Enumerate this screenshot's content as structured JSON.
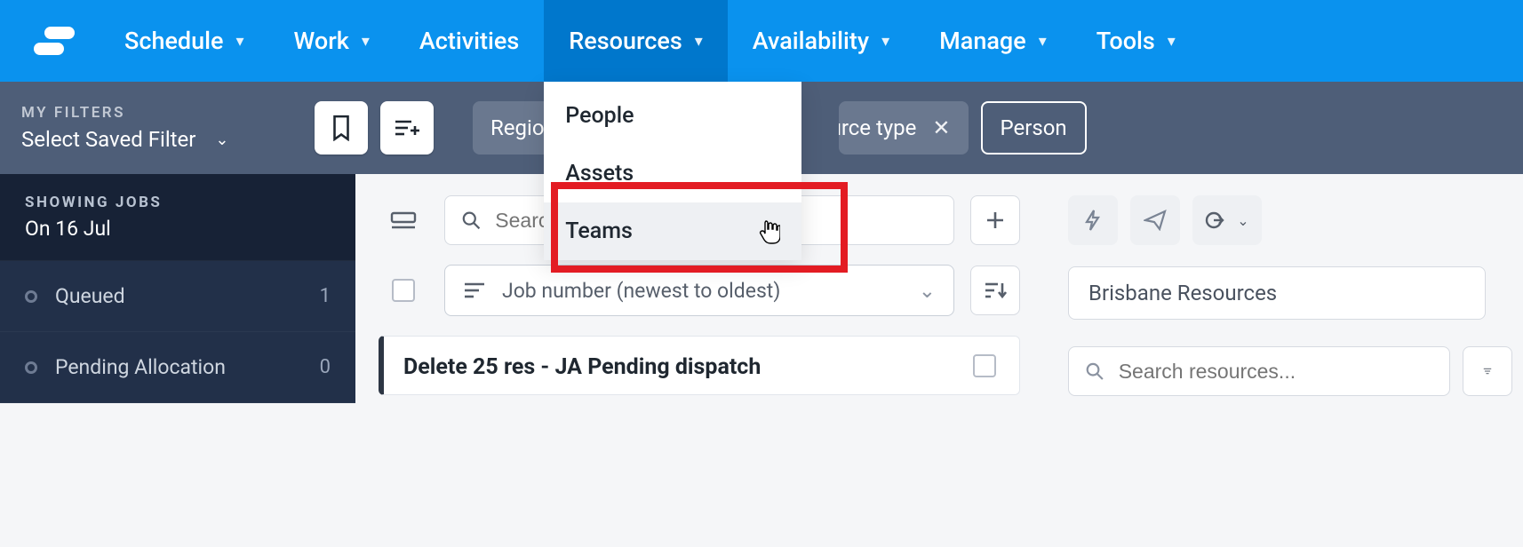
{
  "nav": {
    "schedule": "Schedule",
    "work": "Work",
    "activities": "Activities",
    "resources": "Resources",
    "availability": "Availability",
    "manage": "Manage",
    "tools": "Tools"
  },
  "resources_menu": {
    "people": "People",
    "assets": "Assets",
    "teams": "Teams"
  },
  "filterbar": {
    "my_filters_label": "MY FILTERS",
    "saved_filter": "Select Saved Filter",
    "chip_region": "Region",
    "chip_resource_type": "Resource type",
    "chip_person": "Person"
  },
  "sidebar": {
    "showing_label": "SHOWING JOBS",
    "showing_date": "On 16 Jul",
    "queued": {
      "label": "Queued",
      "count": "1"
    },
    "pending": {
      "label": "Pending Allocation",
      "count": "0"
    }
  },
  "center": {
    "search_placeholder": "Search...",
    "sort_label": "Job number (newest to oldest)",
    "card_title": "Delete 25 res - JA Pending dispatch"
  },
  "right": {
    "header": "Brisbane Resources",
    "search_placeholder": "Search resources..."
  }
}
